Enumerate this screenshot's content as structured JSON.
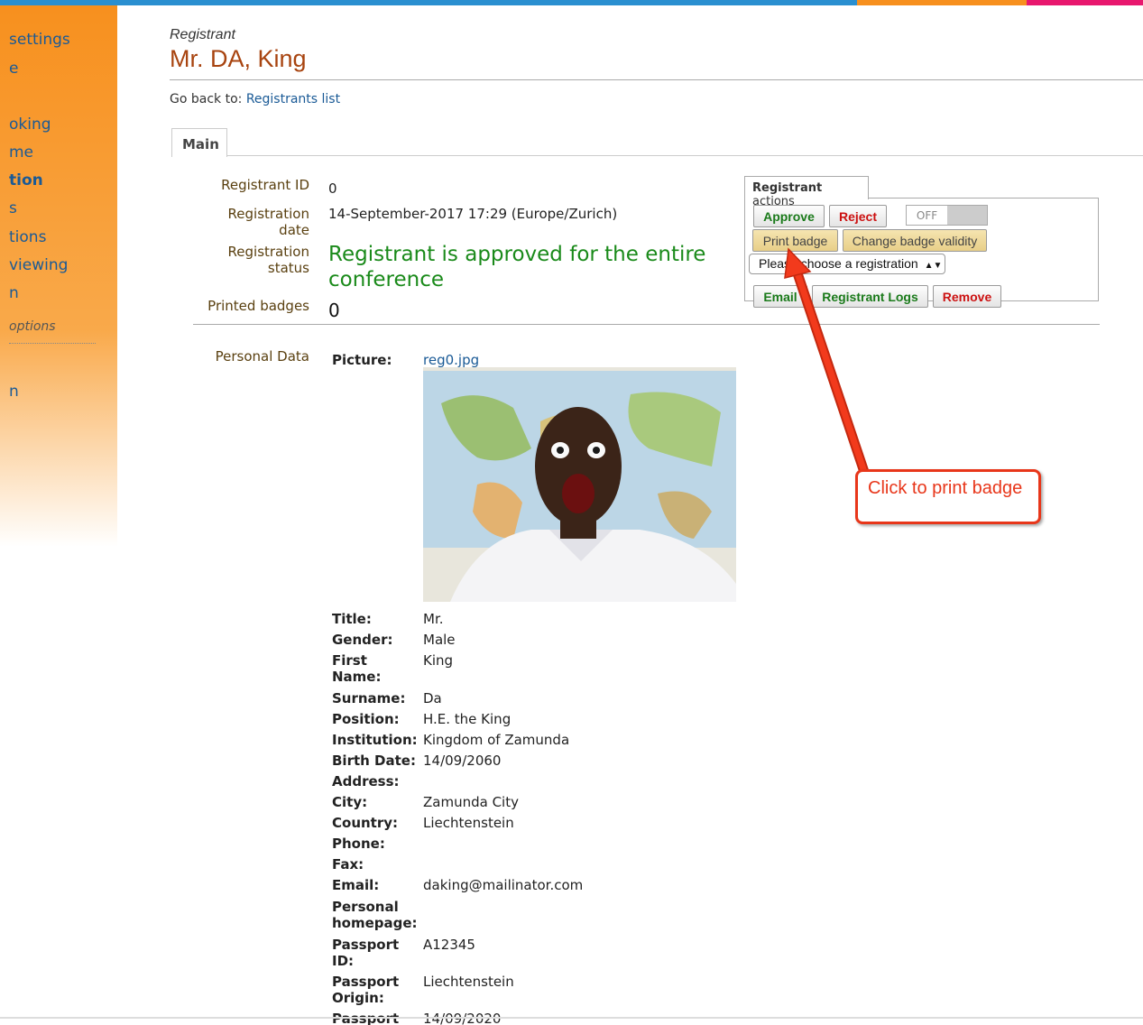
{
  "colors": {
    "bar_blue": "#2a8fd0",
    "bar_orange": "#f7901e",
    "bar_pink": "#e8176e",
    "accent_title": "#a84410",
    "status_green": "#1a8a1a",
    "callout_red": "#e8361a"
  },
  "sidebar": {
    "items": [
      "settings",
      "e",
      "oking",
      "me",
      "tion",
      "s",
      "tions",
      "viewing",
      "n",
      "options",
      "n"
    ]
  },
  "header": {
    "subtitle": "Registrant",
    "title": "Mr. DA, King"
  },
  "goback": {
    "prefix": "Go back to:",
    "link": "Registrants list"
  },
  "tabs": {
    "main": "Main"
  },
  "summary": {
    "id_label": "Registrant ID",
    "id_value": "0",
    "date_label": "Registration date",
    "date_value": "14-September-2017 17:29 (Europe/Zurich)",
    "status_label": "Registration status",
    "status_value": "Registrant is approved for the entire conference",
    "printed_label": "Printed badges",
    "printed_value": "0"
  },
  "actions": {
    "tab_bold": "Registrant",
    "tab_rest": "actions",
    "approve": "Approve",
    "reject": "Reject",
    "toggle": "OFF",
    "print_badge": "Print badge",
    "change_validity": "Change badge validity",
    "select_value": "Please choose a registration",
    "email": "Email",
    "logs": "Registrant Logs",
    "remove": "Remove"
  },
  "personal": {
    "section_label": "Personal Data",
    "picture_label": "Picture:",
    "picture_file": "reg0.jpg",
    "fields": [
      {
        "key": "Title:",
        "value": "Mr."
      },
      {
        "key": "Gender:",
        "value": "Male"
      },
      {
        "key": "First Name:",
        "value": "King"
      },
      {
        "key": "Surname:",
        "value": "Da"
      },
      {
        "key": "Position:",
        "value": "H.E. the King"
      },
      {
        "key": "Institution:",
        "value": "Kingdom of Zamunda"
      },
      {
        "key": "Birth Date:",
        "value": "14/09/2060"
      },
      {
        "key": "Address:",
        "value": ""
      },
      {
        "key": "City:",
        "value": "Zamunda City"
      },
      {
        "key": "Country:",
        "value": "Liechtenstein"
      },
      {
        "key": "Phone:",
        "value": ""
      },
      {
        "key": "Fax:",
        "value": ""
      },
      {
        "key": "Email:",
        "value": "daking@mailinator.com"
      },
      {
        "key": "Personal homepage:",
        "value": ""
      },
      {
        "key": "Passport ID:",
        "value": "A12345"
      },
      {
        "key": "Passport Origin:",
        "value": "Liechtenstein"
      },
      {
        "key": "Passport",
        "value": "14/09/2020"
      }
    ]
  },
  "callout": {
    "text": "Click to print badge"
  }
}
